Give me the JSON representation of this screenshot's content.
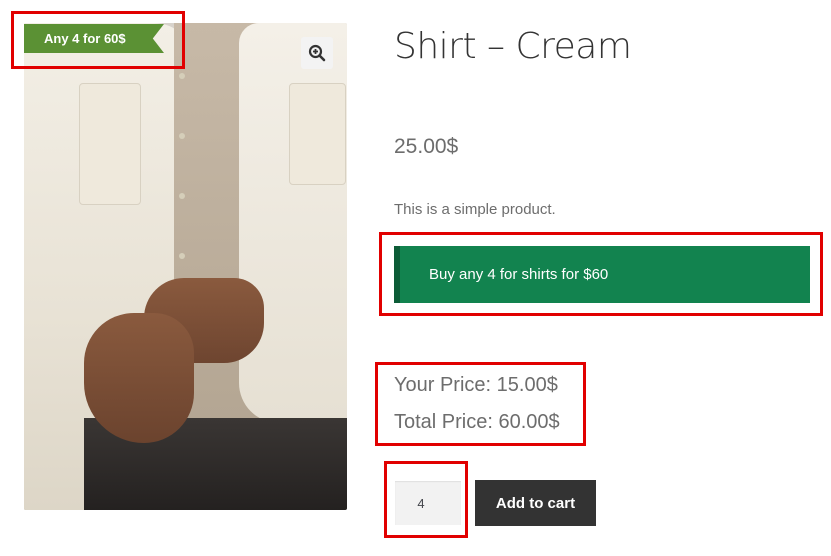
{
  "product": {
    "sale_flash": "Any 4 for 60$",
    "title": "Shirt – Cream",
    "price": "25.00$",
    "short_description": "This is a simple product.",
    "bundle_offer": "Buy any 4 for shirts for $60",
    "your_price": "Your Price: 15.00$",
    "total_price": "Total Price: 60.00$",
    "quantity": "4",
    "add_to_cart_label": "Add to cart"
  },
  "icons": {
    "zoom": "zoom-in-magnifier-icon"
  },
  "colors": {
    "sale_flash_bg": "#5b9134",
    "bundle_offer_bg": "#12834f",
    "add_to_cart_bg": "#333333",
    "highlight_outline": "#e10000"
  }
}
